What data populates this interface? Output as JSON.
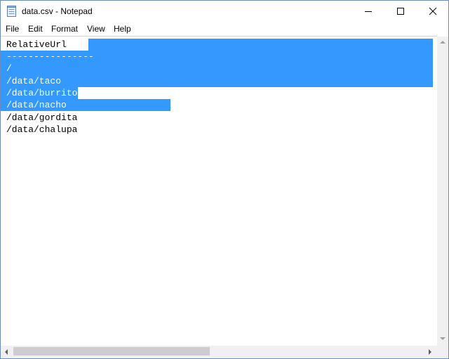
{
  "window": {
    "title": "data.csv - Notepad"
  },
  "menu": [
    "File",
    "Edit",
    "Format",
    "View",
    "Help"
  ],
  "editor": {
    "lines": [
      "RelativeUrl",
      "----------------",
      "/",
      "/data/taco",
      "/data/burrito",
      "/data/nacho",
      "/data/gordita",
      "/data/chalupa"
    ],
    "selection_color": "#3399ff"
  },
  "icons": {
    "app": "notepad-icon",
    "minimize": "minimize-icon",
    "maximize": "maximize-icon",
    "close": "close-icon"
  }
}
